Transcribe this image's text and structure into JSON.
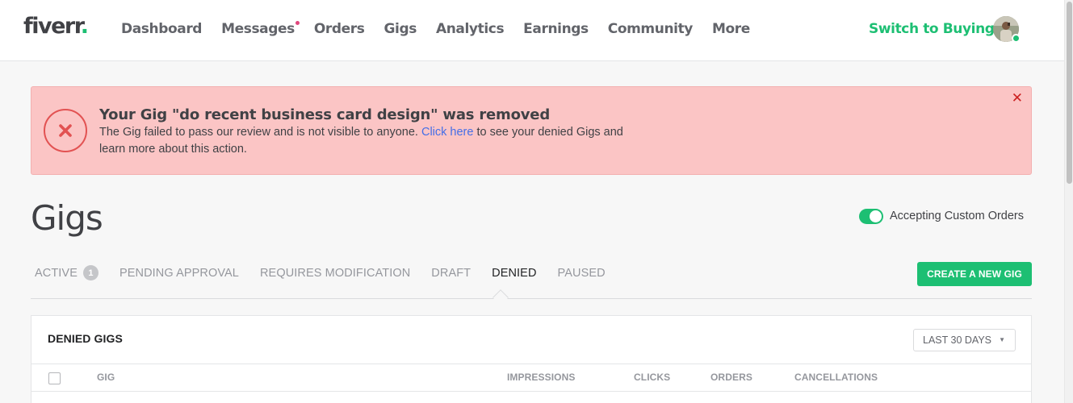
{
  "header": {
    "logo": "fiverr",
    "logo_dot": ".",
    "nav": [
      "Dashboard",
      "Messages",
      "Orders",
      "Gigs",
      "Analytics",
      "Earnings",
      "Community",
      "More"
    ],
    "switch_label": "Switch to Buying"
  },
  "alert": {
    "title": "Your Gig \"do recent business card design\" was removed",
    "body_before": "The Gig failed to pass our review and is not visible to anyone. ",
    "link": "Click here",
    "body_after": " to see your denied Gigs and learn more about this action.",
    "close": "✕"
  },
  "page": {
    "title": "Gigs",
    "toggle_label": "Accepting Custom Orders"
  },
  "tabs": [
    {
      "label": "ACTIVE",
      "count": "1"
    },
    {
      "label": "PENDING APPROVAL"
    },
    {
      "label": "REQUIRES MODIFICATION"
    },
    {
      "label": "DRAFT"
    },
    {
      "label": "DENIED"
    },
    {
      "label": "PAUSED"
    }
  ],
  "create_button": "CREATE A NEW GIG",
  "panel": {
    "title": "DENIED GIGS",
    "range": "LAST 30 DAYS",
    "columns": [
      "GIG",
      "IMPRESSIONS",
      "CLICKS",
      "ORDERS",
      "CANCELLATIONS"
    ]
  },
  "colors": {
    "brand_green": "#1dbf73",
    "alert_bg": "#fbc5c5",
    "alert_red": "#e25252",
    "link_blue": "#446ee7",
    "notification_pink": "#e0467d"
  }
}
